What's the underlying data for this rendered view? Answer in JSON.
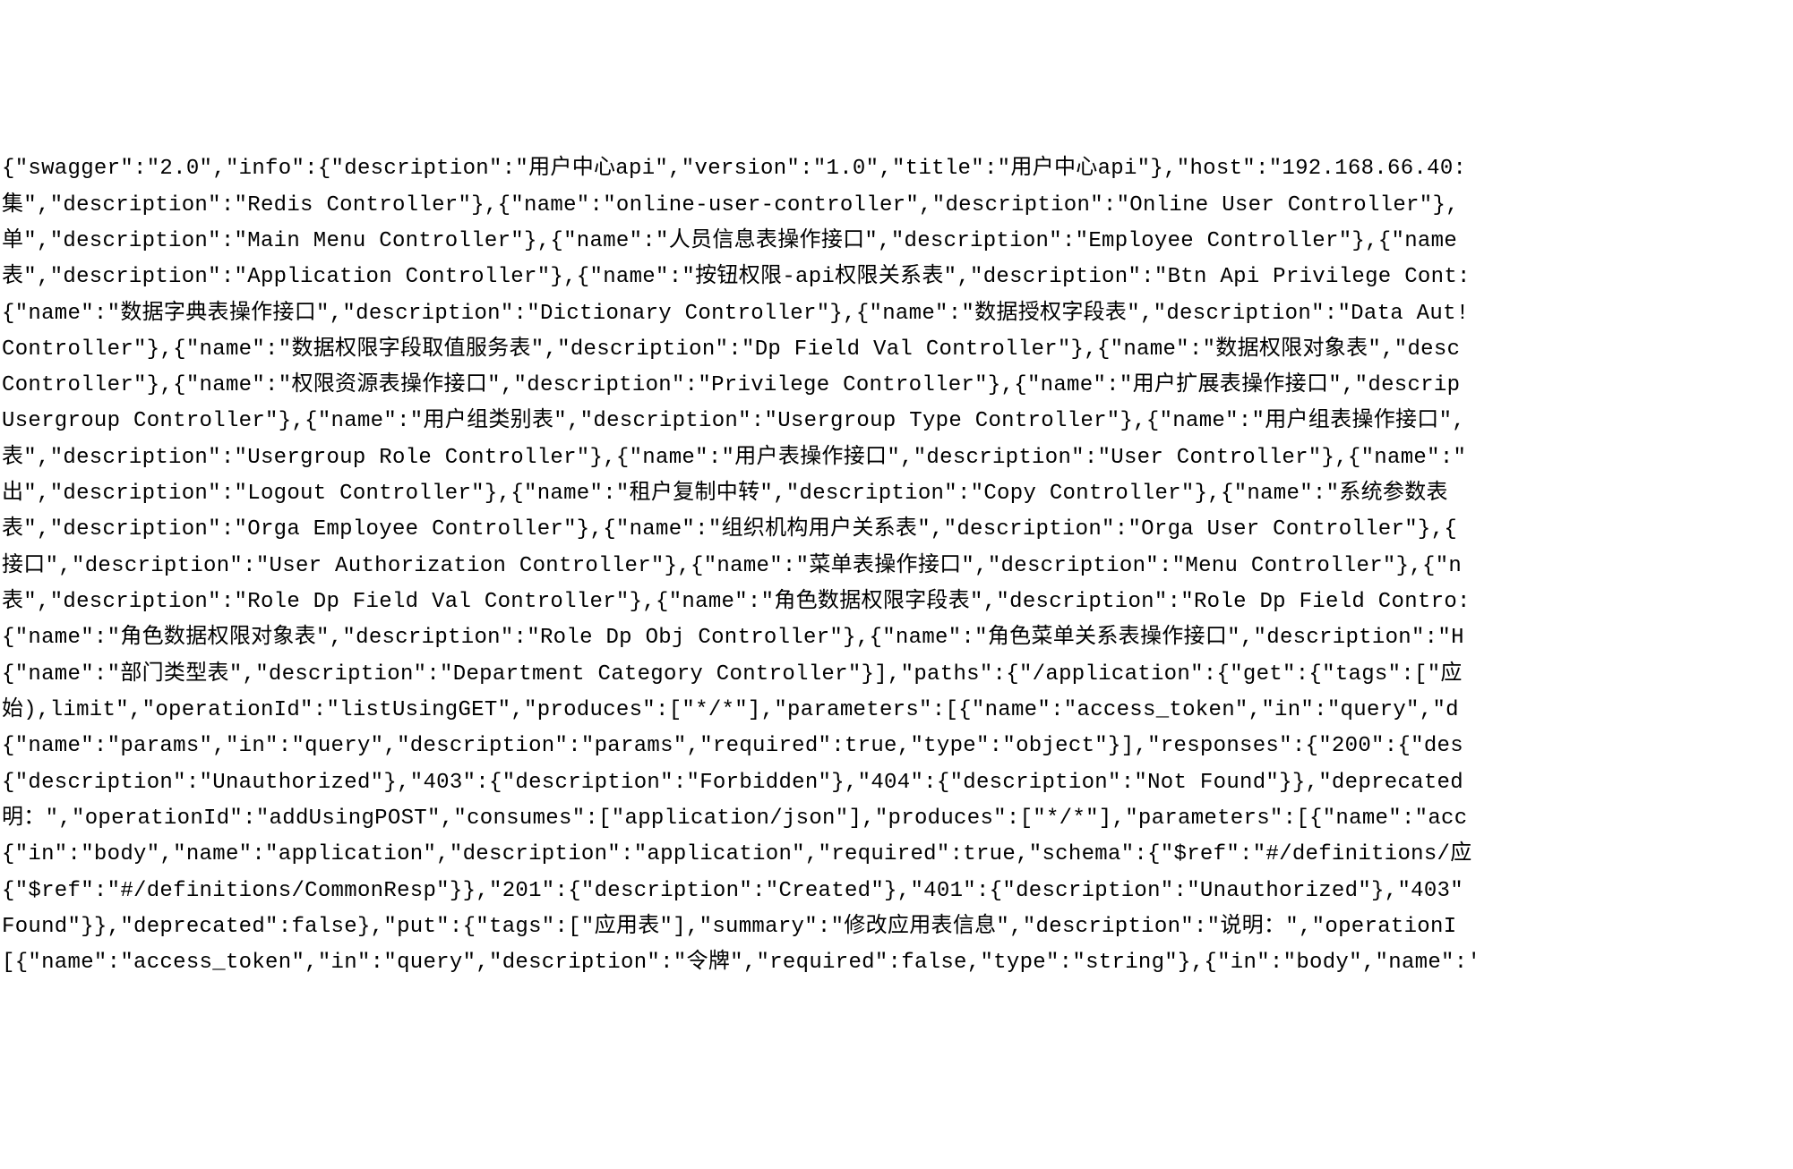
{
  "raw_json_text": "{\"swagger\":\"2.0\",\"info\":{\"description\":\"用户中心api\",\"version\":\"1.0\",\"title\":\"用户中心api\"},\"host\":\"192.168.66.40:\n集\",\"description\":\"Redis Controller\"},{\"name\":\"online-user-controller\",\"description\":\"Online User Controller\"},\n单\",\"description\":\"Main Menu Controller\"},{\"name\":\"人员信息表操作接口\",\"description\":\"Employee Controller\"},{\"name\n表\",\"description\":\"Application Controller\"},{\"name\":\"按钮权限-api权限关系表\",\"description\":\"Btn Api Privilege Cont:\n{\"name\":\"数据字典表操作接口\",\"description\":\"Dictionary Controller\"},{\"name\":\"数据授权字段表\",\"description\":\"Data Aut!\nController\"},{\"name\":\"数据权限字段取值服务表\",\"description\":\"Dp Field Val Controller\"},{\"name\":\"数据权限对象表\",\"desc\nController\"},{\"name\":\"权限资源表操作接口\",\"description\":\"Privilege Controller\"},{\"name\":\"用户扩展表操作接口\",\"descrip\nUsergroup Controller\"},{\"name\":\"用户组类别表\",\"description\":\"Usergroup Type Controller\"},{\"name\":\"用户组表操作接口\",\n表\",\"description\":\"Usergroup Role Controller\"},{\"name\":\"用户表操作接口\",\"description\":\"User Controller\"},{\"name\":\"\n出\",\"description\":\"Logout Controller\"},{\"name\":\"租户复制中转\",\"description\":\"Copy Controller\"},{\"name\":\"系统参数表\n表\",\"description\":\"Orga Employee Controller\"},{\"name\":\"组织机构用户关系表\",\"description\":\"Orga User Controller\"},{\n接口\",\"description\":\"User Authorization Controller\"},{\"name\":\"菜单表操作接口\",\"description\":\"Menu Controller\"},{\"n\n表\",\"description\":\"Role Dp Field Val Controller\"},{\"name\":\"角色数据权限字段表\",\"description\":\"Role Dp Field Contro:\n{\"name\":\"角色数据权限对象表\",\"description\":\"Role Dp Obj Controller\"},{\"name\":\"角色菜单关系表操作接口\",\"description\":\"H\n{\"name\":\"部门类型表\",\"description\":\"Department Category Controller\"}],\"paths\":{\"/application\":{\"get\":{\"tags\":[\"应\n始),limit\",\"operationId\":\"listUsingGET\",\"produces\":[\"*/*\"],\"parameters\":[{\"name\":\"access_token\",\"in\":\"query\",\"d\n{\"name\":\"params\",\"in\":\"query\",\"description\":\"params\",\"required\":true,\"type\":\"object\"}],\"responses\":{\"200\":{\"des\n{\"description\":\"Unauthorized\"},\"403\":{\"description\":\"Forbidden\"},\"404\":{\"description\":\"Not Found\"}},\"deprecated\n明：\",\"operationId\":\"addUsingPOST\",\"consumes\":[\"application/json\"],\"produces\":[\"*/*\"],\"parameters\":[{\"name\":\"acc\n{\"in\":\"body\",\"name\":\"application\",\"description\":\"application\",\"required\":true,\"schema\":{\"$ref\":\"#/definitions/应\n{\"$ref\":\"#/definitions/CommonResp\"}},\"201\":{\"description\":\"Created\"},\"401\":{\"description\":\"Unauthorized\"},\"403\"\nFound\"}},\"deprecated\":false},\"put\":{\"tags\":[\"应用表\"],\"summary\":\"修改应用表信息\",\"description\":\"说明：\",\"operationI\n[{\"name\":\"access_token\",\"in\":\"query\",\"description\":\"令牌\",\"required\":false,\"type\":\"string\"},{\"in\":\"body\",\"name\":'"
}
